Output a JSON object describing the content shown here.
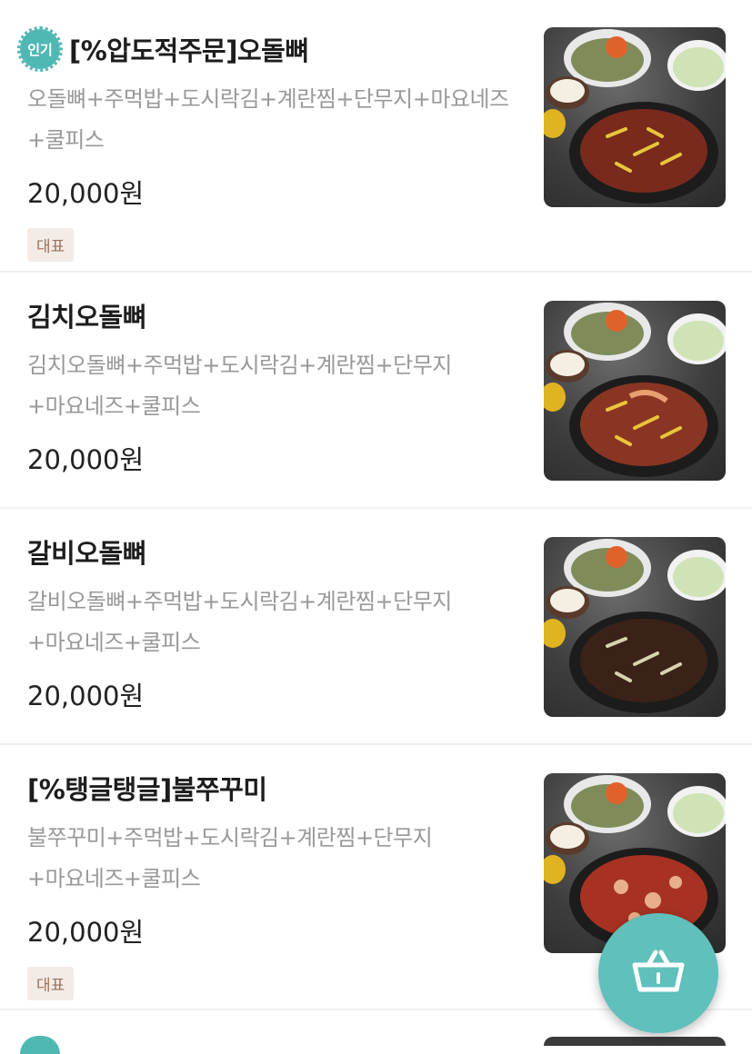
{
  "menu": {
    "items": [
      {
        "badge": "인기",
        "title": "[%압도적주문]오돌뼈",
        "description": "오돌뼈+주먹밥+도시락김+계란찜+단무지+마요네즈+쿨피스",
        "price": "20,000원",
        "tag": "대표",
        "food_color": "#7a2a1c"
      },
      {
        "title": "김치오돌뼈",
        "description": "김치오돌뼈+주먹밥+도시락김+계란찜+단무지+마요네즈+쿨피스",
        "price": "20,000원",
        "food_color": "#8a3524"
      },
      {
        "title": "갈비오돌뼈",
        "description": "갈비오돌뼈+주먹밥+도시락김+계란찜+단무지+마요네즈+쿨피스",
        "price": "20,000원",
        "food_color": "#3a2218"
      },
      {
        "title": "[%탱글탱글]불쭈꾸미",
        "description": "불쭈꾸미+주먹밥+도시락김+계란찜+단무지+마요네즈+쿨피스",
        "price": "20,000원",
        "tag": "대표",
        "food_color": "#a83222"
      }
    ]
  },
  "cart": {
    "icon": "basket-icon",
    "color": "#5fc0bc"
  },
  "colors": {
    "accent": "#4fb8b3",
    "tag_bg": "#f3ece6",
    "tag_text": "#9a7059"
  }
}
